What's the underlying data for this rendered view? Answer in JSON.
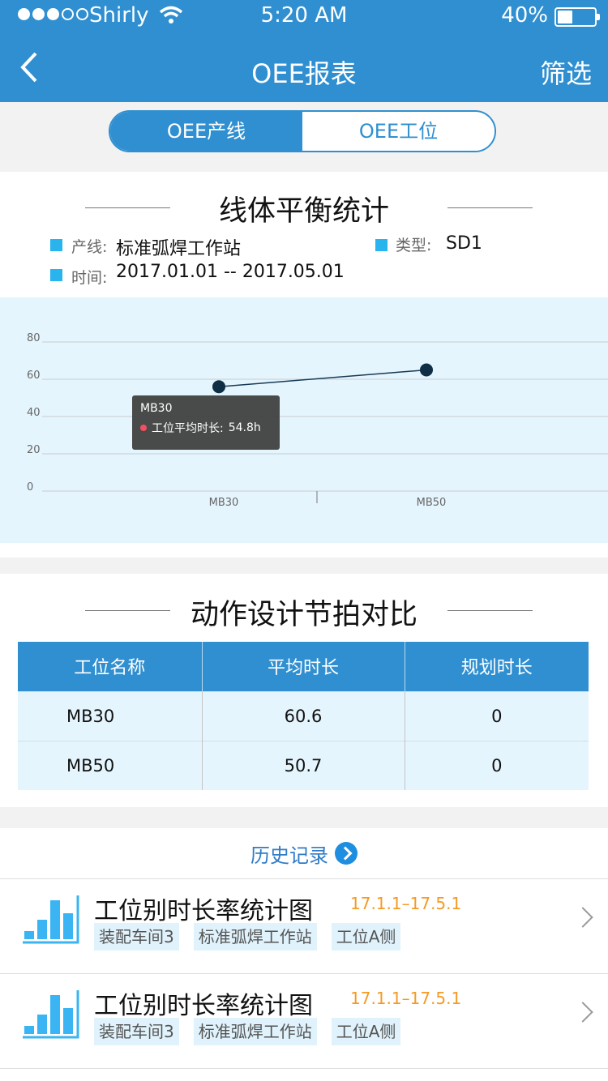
{
  "status_bar": {
    "carrier": "Shirly",
    "time": "5:20 AM",
    "battery": "40%",
    "battery_level": 0.4
  },
  "nav": {
    "title": "OEE报表",
    "filter_label": "筛选"
  },
  "segmented": {
    "tabs": [
      {
        "label": "OEE产线",
        "active": true
      },
      {
        "label": "OEE工位",
        "active": false
      }
    ]
  },
  "balance": {
    "title": "线体平衡统计",
    "line_key": "产线:",
    "line_value": "标准弧焊工作站",
    "type_key": "类型:",
    "type_value": "SD1",
    "time_key": "时间:",
    "time_value": "2017.01.01 -- 2017.05.01",
    "tooltip": {
      "title": "MB30",
      "label": "工位平均时长:",
      "value": "54.8h"
    }
  },
  "chart_data": {
    "type": "line",
    "categories": [
      "MB30",
      "MB50"
    ],
    "series": [
      {
        "values": [
          56,
          65
        ]
      }
    ],
    "y_ticks": [
      "80",
      "60",
      "40",
      "20",
      "0"
    ],
    "ylim": [
      0,
      80
    ],
    "grid": true,
    "colors": {
      "line": "#163a55",
      "point": "#0f2d45",
      "background": "#e5f5fd",
      "grid": "#c8ccd0"
    }
  },
  "comparison": {
    "title": "动作设计节拍对比",
    "headers": [
      "工位名称",
      "平均时长",
      "规划时长"
    ],
    "rows": [
      [
        "MB30",
        "60.6",
        "0"
      ],
      [
        "MB50",
        "50.7",
        "0"
      ]
    ]
  },
  "history": {
    "header": "历史记录",
    "items": [
      {
        "title": "工位别时长率统计图",
        "date": "17.1.1–17.5.1",
        "tags": [
          "装配车间3",
          "标准弧焊工作站",
          "工位A侧"
        ]
      },
      {
        "title": "工位别时长率统计图",
        "date": "17.1.1–17.5.1",
        "tags": [
          "装配车间3",
          "标准弧焊工作站",
          "工位A侧"
        ]
      }
    ]
  },
  "colors": {
    "primary": "#2f8fd0",
    "accent_orange": "#f59a23",
    "info_square": "#29b4ee"
  }
}
